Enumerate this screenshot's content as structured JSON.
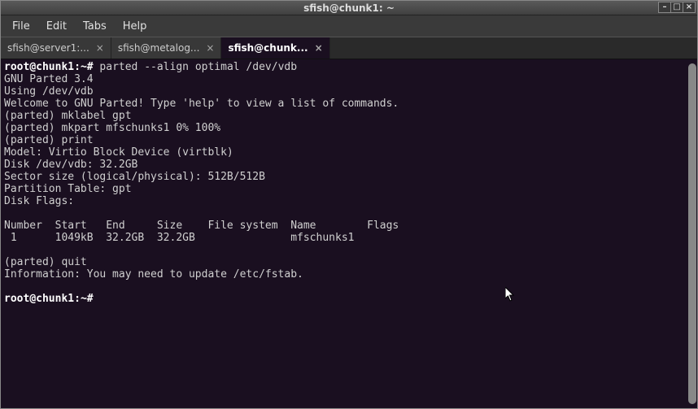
{
  "window": {
    "title": "sfish@chunk1: ~"
  },
  "menu": {
    "file": "File",
    "edit": "Edit",
    "tabs": "Tabs",
    "help": "Help"
  },
  "tabs": [
    {
      "label": "sfish@server1:...",
      "active": false
    },
    {
      "label": "sfish@metalog...",
      "active": false
    },
    {
      "label": "sfish@chunk...",
      "active": true
    }
  ],
  "prompt1": {
    "user": "root",
    "host": "chunk1",
    "path": "~",
    "hash": "#",
    "cmd": " parted --align optimal /dev/vdb"
  },
  "out": {
    "l1": "GNU Parted 3.4",
    "l2": "Using /dev/vdb",
    "l3": "Welcome to GNU Parted! Type 'help' to view a list of commands.",
    "l4": "(parted) mklabel gpt",
    "l5": "(parted) mkpart mfschunks1 0% 100%",
    "l6": "(parted) print",
    "l7": "Model: Virtio Block Device (virtblk)",
    "l8": "Disk /dev/vdb: 32.2GB",
    "l9": "Sector size (logical/physical): 512B/512B",
    "l10": "Partition Table: gpt",
    "l11": "Disk Flags:",
    "l12": "",
    "l13": "Number  Start   End     Size    File system  Name        Flags",
    "l14": " 1      1049kB  32.2GB  32.2GB               mfschunks1",
    "l15": "",
    "l16": "(parted) quit",
    "l17": "Information: You may need to update /etc/fstab.",
    "l18": ""
  },
  "prompt2": {
    "user": "root",
    "host": "chunk1",
    "path": "~",
    "hash": "#",
    "cmd": " "
  },
  "icons": {
    "close_x": "×",
    "min": "–",
    "max": "□"
  }
}
